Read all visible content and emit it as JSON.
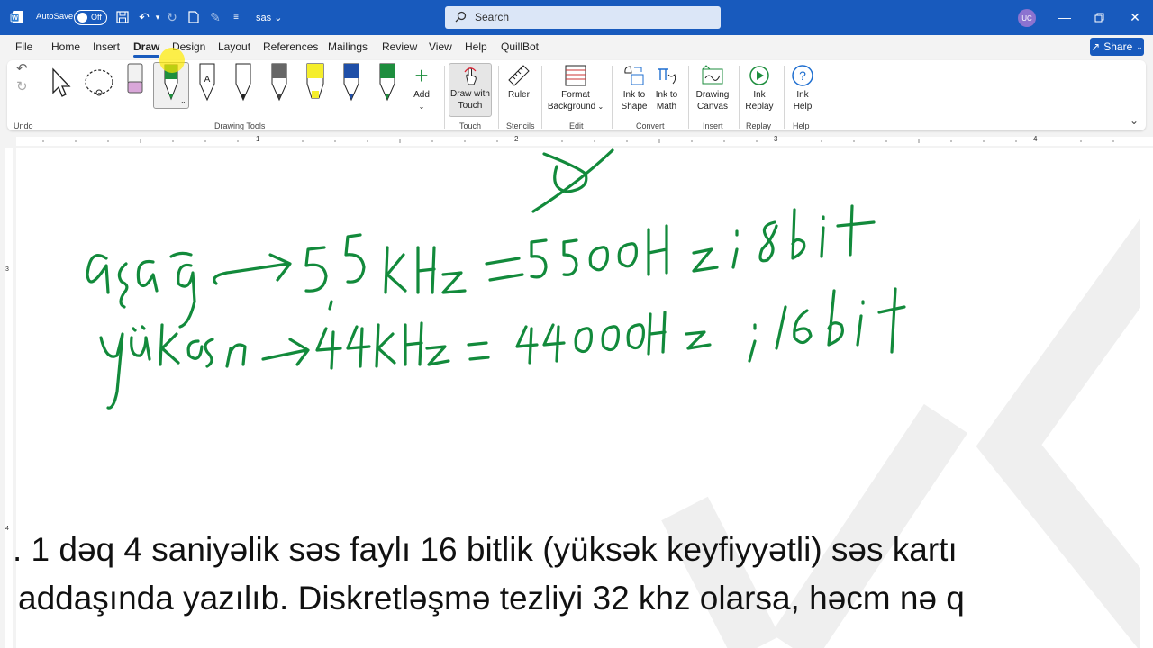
{
  "titlebar": {
    "autosave_label": "AutoSave",
    "autosave_state": "Off",
    "doc_name": "sas",
    "search_placeholder": "Search",
    "user_initials": "UC",
    "accent": "#185abd"
  },
  "tabs": [
    "File",
    "Home",
    "Insert",
    "Draw",
    "Design",
    "Layout",
    "References",
    "Mailings",
    "Review",
    "View",
    "Help",
    "QuillBot"
  ],
  "active_tab": "Draw",
  "share_label": "Share",
  "ribbon": {
    "groups": {
      "undo": "Undo",
      "drawing_tools": "Drawing Tools",
      "touch": "Touch",
      "stencils": "Stencils",
      "edit": "Edit",
      "convert": "Convert",
      "insert": "Insert",
      "replay": "Replay",
      "help": "Help"
    },
    "add_label": "Add",
    "draw_with_touch": [
      "Draw with",
      "Touch"
    ],
    "ruler": "Ruler",
    "format_background": [
      "Format",
      "Background"
    ],
    "ink_to_shape": [
      "Ink to",
      "Shape"
    ],
    "ink_to_math": [
      "Ink to",
      "Math"
    ],
    "drawing_canvas": [
      "Drawing",
      "Canvas"
    ],
    "ink_replay": [
      "Ink",
      "Replay"
    ],
    "ink_help": [
      "Ink",
      "Help"
    ],
    "pen_colors": {
      "green": "#1e8e3e",
      "yellow": "#f5ee2b",
      "blue": "#1f4fa8",
      "pencil": "#444444",
      "eraser": "#d9a7d9"
    }
  },
  "ruler_numbers": [
    "1",
    "2",
    "3",
    "4"
  ],
  "vruler_numbers": [
    "3",
    "4"
  ],
  "ink_color": "#128a3b",
  "document": {
    "para1": ". 1 dəq 4 saniyəlik səs faylı 16 bitlik (yüksək keyfiyyətli) səs kartı",
    "para2": "addaşında yazılıb. Diskretləşmə tezliyi 32 khz olarsa, həcm nə q"
  }
}
